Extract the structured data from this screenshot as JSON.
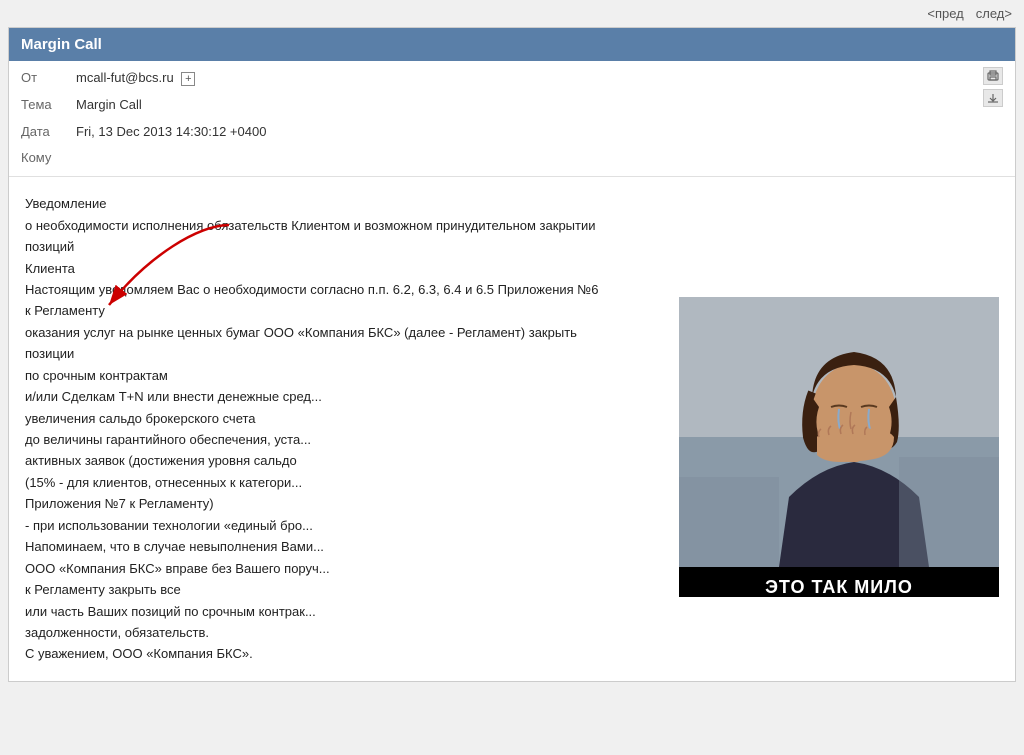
{
  "nav": {
    "prev_label": "<пред",
    "next_label": "след>"
  },
  "email": {
    "title": "Margin Call",
    "from_label": "От",
    "from_value": "mcall-fut@bcs.ru",
    "subject_label": "Тема",
    "subject_value": "Margin Call",
    "date_label": "Дата",
    "date_value": "Fri, 13 Dec 2013 14:30:12 +0400",
    "to_label": "Кому",
    "to_value": ""
  },
  "body": {
    "line1": "Уведомление",
    "line2": "о необходимости исполнения обязательств Клиентом и возможном принудительном закрытии позиций",
    "line3": "Клиента",
    "line4": "Настоящим уведомляем Вас о необходимости согласно п.п. 6.2, 6.3, 6.4 и 6.5 Приложения №6 к Регламенту",
    "line5": "оказания услуг на рынке ценных бумаг ООО «Компания БКС» (далее - Регламент) закрыть позиции",
    "line6": "по срочным контрактам",
    "line7": "и/или Сделкам Т+N или внести денежные сред...",
    "line8": "увеличения сальдо брокерского счета",
    "line9": "до величины гарантийного обеспечения, уста...",
    "line10": "активных заявок (достижения уровня сальдо",
    "line11": "(15% - для клиентов, отнесенных к категори...",
    "line12": "Приложения №7 к Регламенту)",
    "line13": "- при использовании технологии «единый бро...",
    "line14": "Напоминаем, что в случае невыполнения Вами...",
    "line15": "ООО «Компания БКС» вправе без Вашего поруч...",
    "line16": "к Регламенту закрыть все",
    "line17": "или часть Ваших позиций по срочным контрак...",
    "line18": "задолженности, обязательств.",
    "line19": "С уважением, ООО «Компания БКС»."
  },
  "meme": {
    "caption": "ЭТО ТАК МИЛО"
  }
}
